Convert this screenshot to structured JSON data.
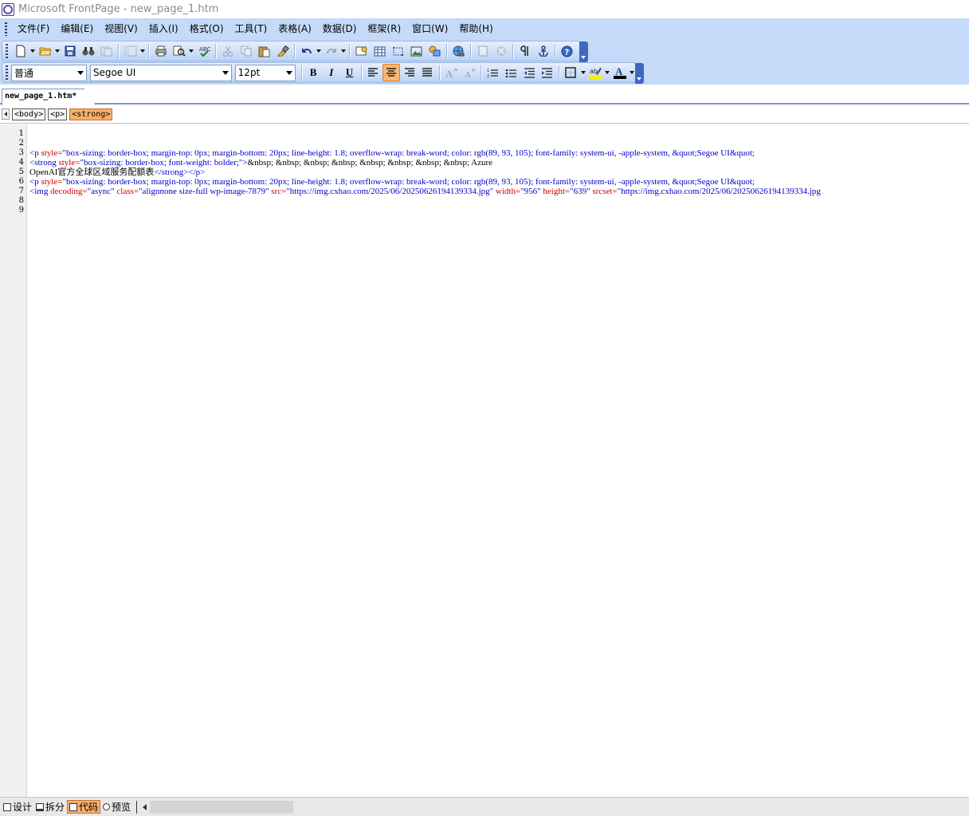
{
  "titlebar": {
    "title": "Microsoft FrontPage - new_page_1.htm"
  },
  "menu": {
    "items": [
      "文件(F)",
      "编辑(E)",
      "视图(V)",
      "插入(I)",
      "格式(O)",
      "工具(T)",
      "表格(A)",
      "数据(D)",
      "框架(R)",
      "窗口(W)",
      "帮助(H)"
    ]
  },
  "formatting": {
    "style": "普通",
    "font": "Segoe UI",
    "size": "12pt",
    "bold": "B",
    "italic": "I",
    "underline": "U"
  },
  "doc_tab": {
    "label": "new_page_1.htm*"
  },
  "quicktags": {
    "items": [
      "<body>",
      "<p>",
      "<strong>"
    ],
    "selected": "<strong>"
  },
  "code": {
    "line_numbers": [
      "1",
      "2",
      "3",
      "4",
      "5",
      "6",
      "7",
      "8",
      "9"
    ],
    "lines": [
      {
        "num": "3",
        "parts": [
          {
            "k": "tag",
            "t": "<p "
          },
          {
            "k": "attr",
            "t": "style="
          },
          {
            "k": "tag",
            "t": "\"box-sizing: border-box; margin-top: 0px; margin-bottom: 20px; line-height: 1.8; overflow-wrap: break-word; color: rgb(89, 93, 105); font-family: system-ui, -apple-system, &quot;Segoe UI&quot;"
          }
        ]
      },
      {
        "num": "4",
        "parts": [
          {
            "k": "tag",
            "t": "<strong "
          },
          {
            "k": "attr",
            "t": "style="
          },
          {
            "k": "tag",
            "t": "\"box-sizing: border-box; font-weight: bolder;\">"
          },
          {
            "k": "txt",
            "t": "&nbsp; &nbsp; &nbsp; &nbsp; &nbsp; &nbsp; &nbsp; &nbsp; Azure"
          }
        ]
      },
      {
        "num": "5",
        "parts": [
          {
            "k": "txt",
            "t": "OpenAI官方全球区域服务配额表"
          },
          {
            "k": "tag",
            "t": "</strong></p>"
          }
        ]
      },
      {
        "num": "6",
        "parts": [
          {
            "k": "tag",
            "t": "<p "
          },
          {
            "k": "attr",
            "t": "style="
          },
          {
            "k": "tag",
            "t": "\"box-sizing: border-box; margin-top: 0px; margin-bottom: 20px; line-height: 1.8; overflow-wrap: break-word; color: rgb(89, 93, 105); font-family: system-ui, -apple-system, &quot;Segoe UI&quot;"
          }
        ]
      },
      {
        "num": "7",
        "parts": [
          {
            "k": "tag",
            "t": "<img "
          },
          {
            "k": "attr",
            "t": "decoding="
          },
          {
            "k": "tag",
            "t": "\"async\" "
          },
          {
            "k": "attr",
            "t": "class="
          },
          {
            "k": "tag",
            "t": "\"alignnone size-full wp-image-7879\" "
          },
          {
            "k": "attr",
            "t": "src="
          },
          {
            "k": "tag",
            "t": "\"https://img.cxhao.com/2025/06/20250626194139334.jpg\" "
          },
          {
            "k": "attr",
            "t": "width="
          },
          {
            "k": "tag",
            "t": "\"956\" "
          },
          {
            "k": "attr",
            "t": "height="
          },
          {
            "k": "tag",
            "t": "\"639\" "
          },
          {
            "k": "attr",
            "t": "srcset="
          },
          {
            "k": "tag",
            "t": "\"https://img.cxhao.com/2025/06/20250626194139334.jpg"
          }
        ]
      }
    ]
  },
  "view_tabs": [
    {
      "label": "设计",
      "icon": "design-view-icon"
    },
    {
      "label": "拆分",
      "icon": "split-view-icon"
    },
    {
      "label": "代码",
      "icon": "code-view-icon",
      "selected": true
    },
    {
      "label": "预览",
      "icon": "preview-view-icon"
    }
  ],
  "colors": {
    "tag": "#0000cc",
    "attr": "#cc0000",
    "toolbar": "#c4daf8",
    "active": "#f7b772"
  }
}
